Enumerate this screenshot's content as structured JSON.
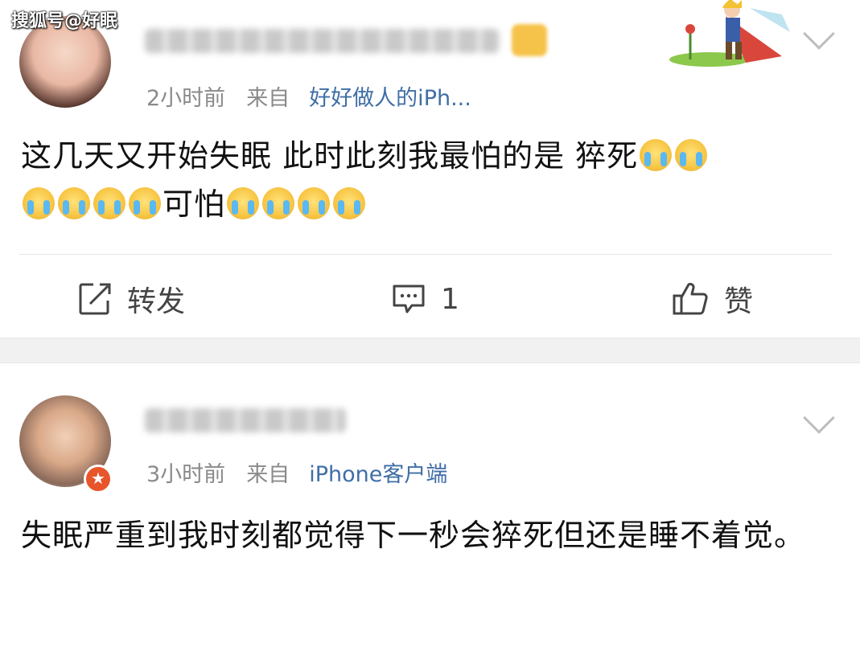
{
  "watermark": "搜狐号@好眠",
  "post1": {
    "time": "2小时前",
    "from_label": "来自",
    "source": "好好做人的iPh...",
    "text_line1": "这几天又开始失眠 此时此刻我最怕的是 猝死",
    "text_line2_mid": "可怕",
    "actions": {
      "repost": "转发",
      "comment_count": "1",
      "like": "赞"
    }
  },
  "post2": {
    "time": "3小时前",
    "from_label": "来自",
    "source": "iPhone客户端",
    "text": "失眠严重到我时刻都觉得下一秒会猝死但还是睡不着觉。"
  },
  "icons": {
    "repost": "edit-icon",
    "comment": "comment-icon",
    "like": "thumbs-up-icon",
    "more": "chevron-down-icon"
  }
}
